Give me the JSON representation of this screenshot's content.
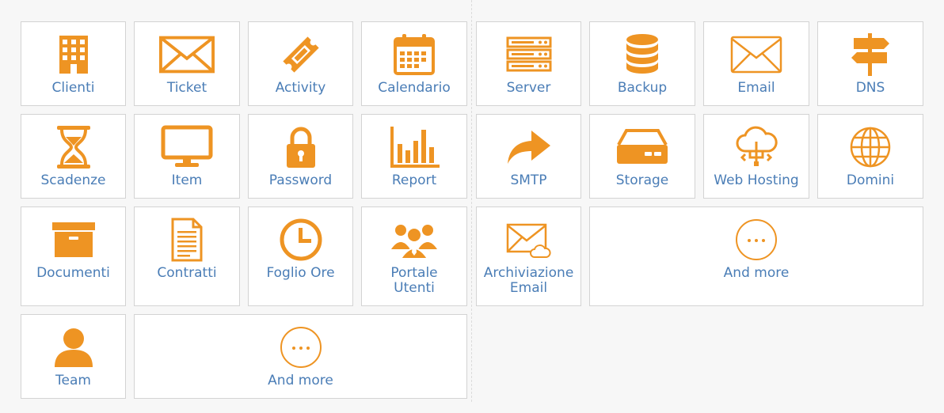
{
  "colors": {
    "icon": "#ee9423",
    "label": "#4a7db6",
    "tile_background": "#ffffff",
    "tile_border": "#d3d3d3",
    "page_background": "#f7f7f7"
  },
  "left_group": {
    "tiles": [
      {
        "label": "Clienti",
        "icon": "building-icon"
      },
      {
        "label": "Ticket",
        "icon": "envelope-icon"
      },
      {
        "label": "Activity",
        "icon": "ticket-icon"
      },
      {
        "label": "Calendario",
        "icon": "calendar-icon"
      },
      {
        "label": "Scadenze",
        "icon": "hourglass-icon"
      },
      {
        "label": "Item",
        "icon": "monitor-icon"
      },
      {
        "label": "Password",
        "icon": "padlock-icon"
      },
      {
        "label": "Report",
        "icon": "bar-chart-icon"
      },
      {
        "label": "Documenti",
        "icon": "archive-box-icon"
      },
      {
        "label": "Contratti",
        "icon": "document-icon"
      },
      {
        "label": "Foglio Ore",
        "icon": "clock-icon"
      },
      {
        "label": "Portale\nUtenti",
        "icon": "users-group-icon"
      },
      {
        "label": "Team",
        "icon": "user-icon"
      },
      {
        "label": "And more",
        "icon": "more-dots-icon"
      }
    ]
  },
  "right_group": {
    "tiles": [
      {
        "label": "Server",
        "icon": "server-rack-icon"
      },
      {
        "label": "Backup",
        "icon": "database-icon"
      },
      {
        "label": "Email",
        "icon": "envelope-icon"
      },
      {
        "label": "DNS",
        "icon": "signpost-icon"
      },
      {
        "label": "SMTP",
        "icon": "share-arrow-icon"
      },
      {
        "label": "Storage",
        "icon": "hard-drive-icon"
      },
      {
        "label": "Web Hosting",
        "icon": "cloud-network-icon"
      },
      {
        "label": "Domini",
        "icon": "globe-icon"
      },
      {
        "label": "Archiviazione\nEmail",
        "icon": "email-cloud-icon"
      },
      {
        "label": "And more",
        "icon": "more-dots-icon"
      }
    ]
  }
}
